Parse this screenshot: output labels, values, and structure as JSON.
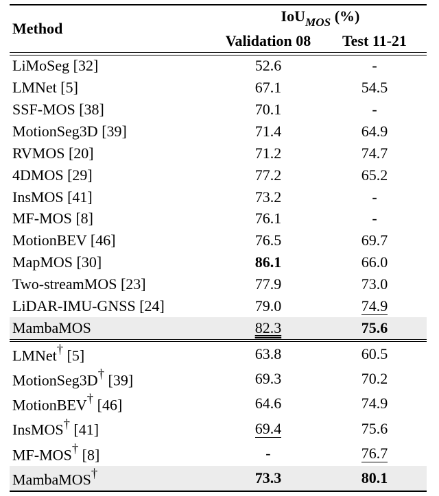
{
  "chart_data": {
    "type": "table",
    "title": "IoU_MOS (%) comparison of MOS methods",
    "columns": [
      "Method",
      "Validation 08",
      "Test 11-21"
    ],
    "sections": [
      {
        "rows": [
          {
            "method": "LiMoSeg [32]",
            "val": "52.6",
            "test": "-"
          },
          {
            "method": "LMNet [5]",
            "val": "67.1",
            "test": "54.5"
          },
          {
            "method": "SSF-MOS [38]",
            "val": "70.1",
            "test": "-"
          },
          {
            "method": "MotionSeg3D [39]",
            "val": "71.4",
            "test": "64.9"
          },
          {
            "method": "RVMOS [20]",
            "val": "71.2",
            "test": "74.7"
          },
          {
            "method": "4DMOS [29]",
            "val": "77.2",
            "test": "65.2"
          },
          {
            "method": "InsMOS [41]",
            "val": "73.2",
            "test": "-"
          },
          {
            "method": "MF-MOS [8]",
            "val": "76.1",
            "test": "-"
          },
          {
            "method": "MotionBEV [46]",
            "val": "76.5",
            "test": "69.7"
          },
          {
            "method": "MapMOS [30]",
            "val": "86.1",
            "test": "66.0",
            "val_bold": true
          },
          {
            "method": "Two-streamMOS [23]",
            "val": "77.9",
            "test": "73.0"
          },
          {
            "method": "LiDAR-IMU-GNSS [24]",
            "val": "79.0",
            "test": "74.9",
            "test_u1": true
          },
          {
            "method": "MambaMOS",
            "val": "82.3",
            "test": "75.6",
            "hl": true,
            "val_u2": true,
            "test_bold": true
          }
        ]
      },
      {
        "rows": [
          {
            "method": "LMNet† [5]",
            "val": "63.8",
            "test": "60.5",
            "dag": true
          },
          {
            "method": "MotionSeg3D† [39]",
            "val": "69.3",
            "test": "70.2",
            "dag": true
          },
          {
            "method": "MotionBEV† [46]",
            "val": "64.6",
            "test": "74.9",
            "dag": true
          },
          {
            "method": "InsMOS† [41]",
            "val": "69.4",
            "test": "75.6",
            "dag": true,
            "val_u1": true
          },
          {
            "method": "MF-MOS† [8]",
            "val": "-",
            "test": "76.7",
            "dag": true,
            "test_u1": true
          },
          {
            "method": "MambaMOS†",
            "val": "73.3",
            "test": "80.1",
            "dag": true,
            "hl": true,
            "val_bold": true,
            "test_bold": true
          }
        ]
      }
    ]
  },
  "header": {
    "method": "Method",
    "iou_pre": "IoU",
    "iou_sub": "MOS",
    "iou_post": " (%)",
    "val": "Validation 08",
    "test": "Test 11-21"
  },
  "rows": [
    {
      "m0": "LiMoSeg",
      "m1": " [32]",
      "v": "52.6",
      "t": "-"
    },
    {
      "m0": "LMNet",
      "m1": " [5]",
      "v": "67.1",
      "t": "54.5"
    },
    {
      "m0": "SSF-MOS",
      "m1": " [38]",
      "v": "70.1",
      "t": "-"
    },
    {
      "m0": "MotionSeg3D",
      "m1": " [39]",
      "v": "71.4",
      "t": "64.9"
    },
    {
      "m0": "RVMOS",
      "m1": " [20]",
      "v": "71.2",
      "t": "74.7"
    },
    {
      "m0": "4DMOS",
      "m1": " [29]",
      "v": "77.2",
      "t": "65.2"
    },
    {
      "m0": "InsMOS",
      "m1": " [41]",
      "v": "73.2",
      "t": "-"
    },
    {
      "m0": "MF-MOS",
      "m1": " [8]",
      "v": "76.1",
      "t": "-"
    },
    {
      "m0": "MotionBEV",
      "m1": " [46]",
      "v": "76.5",
      "t": "69.7"
    },
    {
      "m0": "MapMOS",
      "m1": " [30]",
      "v": "86.1",
      "t": "66.0"
    },
    {
      "m0": "Two-streamMOS",
      "m1": " [23]",
      "v": "77.9",
      "t": "73.0"
    },
    {
      "m0": "LiDAR-IMU-GNSS",
      "m1": " [24]",
      "v": "79.0",
      "t": "74.9"
    },
    {
      "m0": "MambaMOS",
      "m1": "",
      "v": "82.3",
      "t": "75.6"
    },
    {
      "m0": "LMNet",
      "m1": " [5]",
      "v": "63.8",
      "t": "60.5"
    },
    {
      "m0": "MotionSeg3D",
      "m1": " [39]",
      "v": "69.3",
      "t": "70.2"
    },
    {
      "m0": "MotionBEV",
      "m1": " [46]",
      "v": "64.6",
      "t": "74.9"
    },
    {
      "m0": "InsMOS",
      "m1": " [41]",
      "v": "69.4",
      "t": "75.6"
    },
    {
      "m0": "MF-MOS",
      "m1": " [8]",
      "v": "-",
      "t": "76.7"
    },
    {
      "m0": "MambaMOS",
      "m1": "",
      "v": "73.3",
      "t": "80.1"
    }
  ]
}
